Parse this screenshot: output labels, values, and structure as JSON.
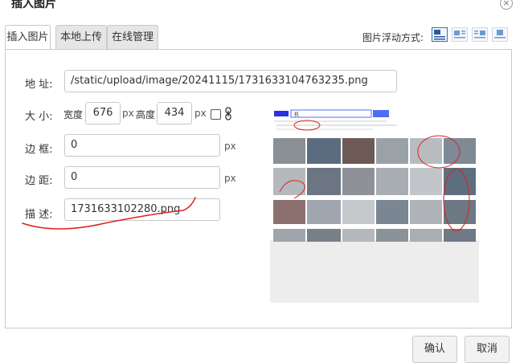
{
  "dialog": {
    "title": "插入图片",
    "close_glyph": "×"
  },
  "tabs": [
    {
      "label": "插入图片",
      "active": true
    },
    {
      "label": "本地上传",
      "active": false
    },
    {
      "label": "在线管理",
      "active": false
    }
  ],
  "float_mode": {
    "label": "图片浮动方式:",
    "options": [
      "float-none-icon",
      "float-left-icon",
      "float-right-icon",
      "float-center-icon"
    ],
    "selected": "float-none-icon"
  },
  "form": {
    "address": {
      "label": "地 址:",
      "value": "/static/upload/image/20241115/1731633104763235.png"
    },
    "size": {
      "label": "大 小:",
      "width_label": "宽度",
      "width_value": "676",
      "width_unit": "px",
      "height_label": "高度",
      "height_value": "434",
      "height_unit": "px",
      "lock_ratio_checked": false
    },
    "border": {
      "label": "边 框:",
      "value": "0",
      "unit": "px"
    },
    "margin": {
      "label": "边 距:",
      "value": "0",
      "unit": "px"
    },
    "description": {
      "label": "描 述:",
      "value": "1731633102280.png"
    }
  },
  "preview": {
    "search_text": "机"
  },
  "buttons": {
    "confirm": "确认",
    "cancel": "取消"
  },
  "colors": {
    "annotation_red": "#e02020",
    "active_tab_bg": "#ffffff",
    "inactive_tab_bg": "#e6e6e6"
  }
}
